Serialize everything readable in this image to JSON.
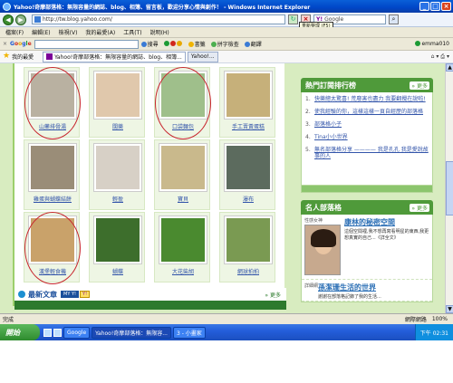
{
  "window": {
    "title": "Yahoo!奇摩部落格：無限容量的網誌、blog、相簿、留言板，歡迎分享心情與創作！ - Windows Internet Explorer",
    "min": "_",
    "max": "□",
    "close": "×"
  },
  "address": {
    "url": "http://tw.blog.yahoo.com/",
    "search_placeholder": "Google",
    "tooltip": "重新整理 (F5)",
    "search_brand": "Y!"
  },
  "menu": [
    "檔案(F)",
    "編輯(E)",
    "檢視(V)",
    "我的最愛(A)",
    "工具(T)",
    "說明(H)"
  ],
  "google_toolbar": {
    "close": "×",
    "logo": [
      "G",
      "o",
      "o",
      "g",
      "l",
      "e"
    ],
    "buttons": [
      "搜尋",
      "書籤",
      "拼字檢查",
      "翻譯"
    ],
    "account": "emma010"
  },
  "favorites": {
    "label": "我的最愛",
    "tab1": "Yahoo!奇摩部落格：無限容量的網誌、blog、相簿...",
    "tab2": "Yahoo!..."
  },
  "photos": [
    {
      "caption": "山藥排骨湯",
      "circled": true,
      "color": "#b9b1a1"
    },
    {
      "caption": "闊樂",
      "circled": false,
      "color": "#e0c8ac"
    },
    {
      "caption": "口袋麵包",
      "circled": true,
      "color": "#9fbf8b"
    },
    {
      "caption": "手工賣黃蛋糕",
      "circled": false,
      "color": "#c6b07a"
    },
    {
      "caption": "雞蛋與蝴蝶結餅",
      "circled": false,
      "color": "#9a8d78"
    },
    {
      "caption": "輕盈",
      "circled": false,
      "color": "#d7d0c6"
    },
    {
      "caption": "寶貝",
      "circled": false,
      "color": "#c9b98c"
    },
    {
      "caption": "瀑布",
      "circled": false,
      "color": "#5c6b5e"
    },
    {
      "caption": "漢堡輕食機",
      "circled": true,
      "color": "#c9a26a"
    },
    {
      "caption": "蝴蝶",
      "circled": false,
      "color": "#3d6e2c"
    },
    {
      "caption": "大花柴胡",
      "circled": false,
      "color": "#4a8a2f"
    },
    {
      "caption": "網球拍拍",
      "circled": false,
      "color": "#7a9a52"
    }
  ],
  "new_articles": {
    "title": "最新文章",
    "badge1": "MY Y!",
    "badge2": "Y!",
    "more": "» 更多"
  },
  "hot_ranking": {
    "title": "熱門訂閱排行榜",
    "more": "» 更多",
    "items": [
      "快樂總太驚喜! 荒廢害也盡力 我要翻攪在說啦!",
      "使我經驗的你，這樣這樣一頁自經歷的部落格",
      "部落格小子",
      "Tina小小世界",
      "無名部落格分享 ———— 我是孔孔 我是愛說故事的人"
    ]
  },
  "people": {
    "title": "名人部落格",
    "more": "» 更多",
    "entries": [
      {
        "tag": "性感女神",
        "name": "康林的秘密空間",
        "desc": "這個空間裡,我不想再寫看明星的東西,我更想真實的自己...《詳全文》"
      },
      {
        "tag": "詳細網",
        "name": "孫潔珊生活的世界",
        "desc": "謝謝在部落格記錄了我的生活..."
      }
    ]
  },
  "status": {
    "left": "完成",
    "zone": "網際網路",
    "zoom": "100%"
  },
  "taskbar": {
    "start": "開始",
    "tasks": [
      "Google",
      "Yahoo!奇摩部落格：無限容...",
      "3 - 小畫家"
    ],
    "clock": "下午 02:31"
  }
}
